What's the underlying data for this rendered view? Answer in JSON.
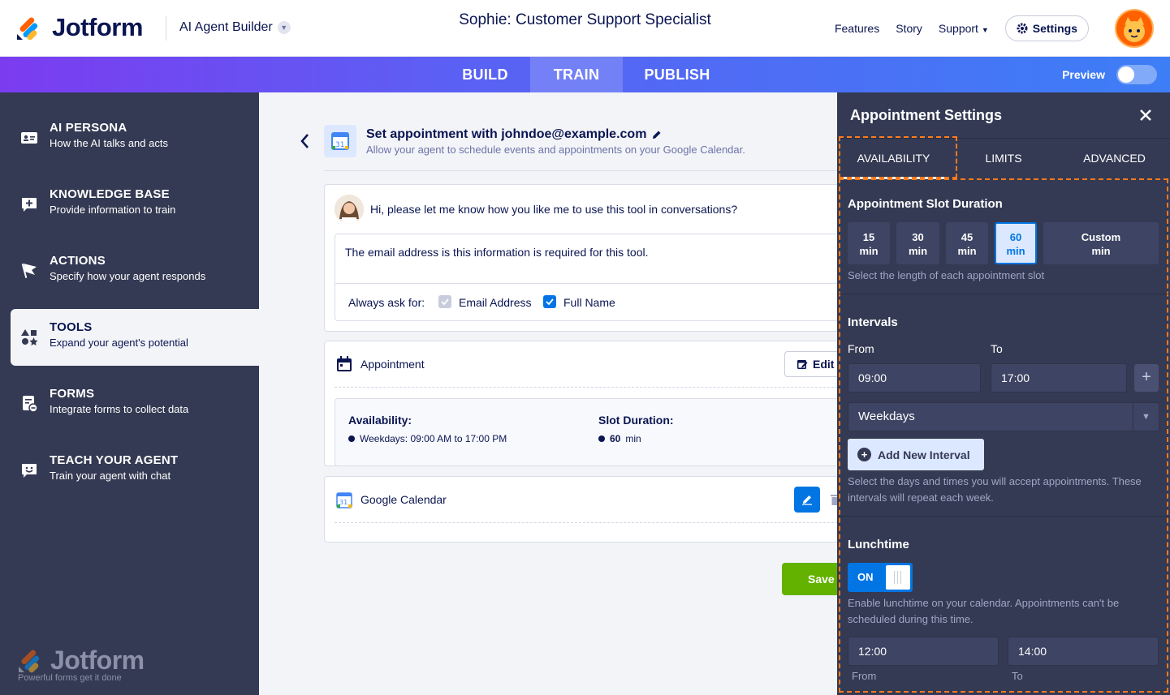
{
  "header": {
    "brand": "Jotform",
    "builder_label": "AI Agent Builder",
    "agent_title": "Sophie: Customer Support Specialist",
    "nav": {
      "features": "Features",
      "story": "Story",
      "support": "Support",
      "settings": "Settings"
    }
  },
  "tabs": {
    "build": "BUILD",
    "train": "TRAIN",
    "publish": "PUBLISH",
    "preview": "Preview",
    "active": "TRAIN"
  },
  "sidebar": {
    "items": [
      {
        "title": "AI PERSONA",
        "subtitle": "How the AI talks and acts"
      },
      {
        "title": "KNOWLEDGE BASE",
        "subtitle": "Provide information to train"
      },
      {
        "title": "ACTIONS",
        "subtitle": "Specify how your agent responds"
      },
      {
        "title": "TOOLS",
        "subtitle": "Expand your agent's potential"
      },
      {
        "title": "FORMS",
        "subtitle": "Integrate forms to collect data"
      },
      {
        "title": "TEACH YOUR AGENT",
        "subtitle": "Train your agent with chat"
      }
    ],
    "active_item": "TOOLS",
    "footer_brand": "Jotform",
    "footer_tagline": "Powerful forms get it done"
  },
  "main": {
    "tool_title": "Set appointment with johndoe@example.com",
    "tool_desc": "Allow your agent to schedule events and appointments on your Google Calendar.",
    "bot_message": "Hi, please let me know how you like me to use this tool in conversations?",
    "instruction": "The email address is this information is required for this tool.",
    "always_ask": "Always ask for:",
    "ask_fields": [
      {
        "label": "Email Address",
        "checked": true,
        "disabled": true
      },
      {
        "label": "Full Name",
        "checked": true,
        "disabled": false
      }
    ],
    "appointment": {
      "title": "Appointment",
      "edit_label": "Edit",
      "availability_label": "Availability:",
      "availability_value": "Weekdays: 09:00 AM to 17:00 PM",
      "slot_label": "Slot Duration:",
      "slot_value": "60",
      "slot_unit": "min"
    },
    "google_calendar": "Google Calendar",
    "save_label": "Save"
  },
  "panel": {
    "title": "Appointment Settings",
    "tabs": [
      "AVAILABILITY",
      "LIMITS",
      "ADVANCED"
    ],
    "active_tab": "AVAILABILITY",
    "slot_section": "Appointment Slot Duration",
    "slots": [
      {
        "value": "15",
        "unit": "min"
      },
      {
        "value": "30",
        "unit": "min"
      },
      {
        "value": "45",
        "unit": "min"
      },
      {
        "value": "60",
        "unit": "min"
      },
      {
        "value": "Custom",
        "unit": "min"
      }
    ],
    "selected_slot": "60",
    "slot_hint": "Select the length of each appointment slot",
    "intervals_section": "Intervals",
    "from_label": "From",
    "to_label": "To",
    "from_value": "09:00",
    "to_value": "17:00",
    "days_value": "Weekdays",
    "add_interval": "Add New Interval",
    "intervals_hint": "Select the days and times you will accept appointments. These intervals will repeat each week.",
    "lunch_section": "Lunchtime",
    "lunch_toggle": "ON",
    "lunch_hint": "Enable lunchtime on your calendar. Appointments can't be scheduled during this time.",
    "lunch_from": "12:00",
    "lunch_to": "14:00",
    "lunch_from_label": "From",
    "lunch_to_label": "To"
  },
  "colors": {
    "accent": "#0075e3",
    "panel_bg": "#343a53",
    "highlight": "#ff7b1c",
    "save": "#64b200"
  }
}
